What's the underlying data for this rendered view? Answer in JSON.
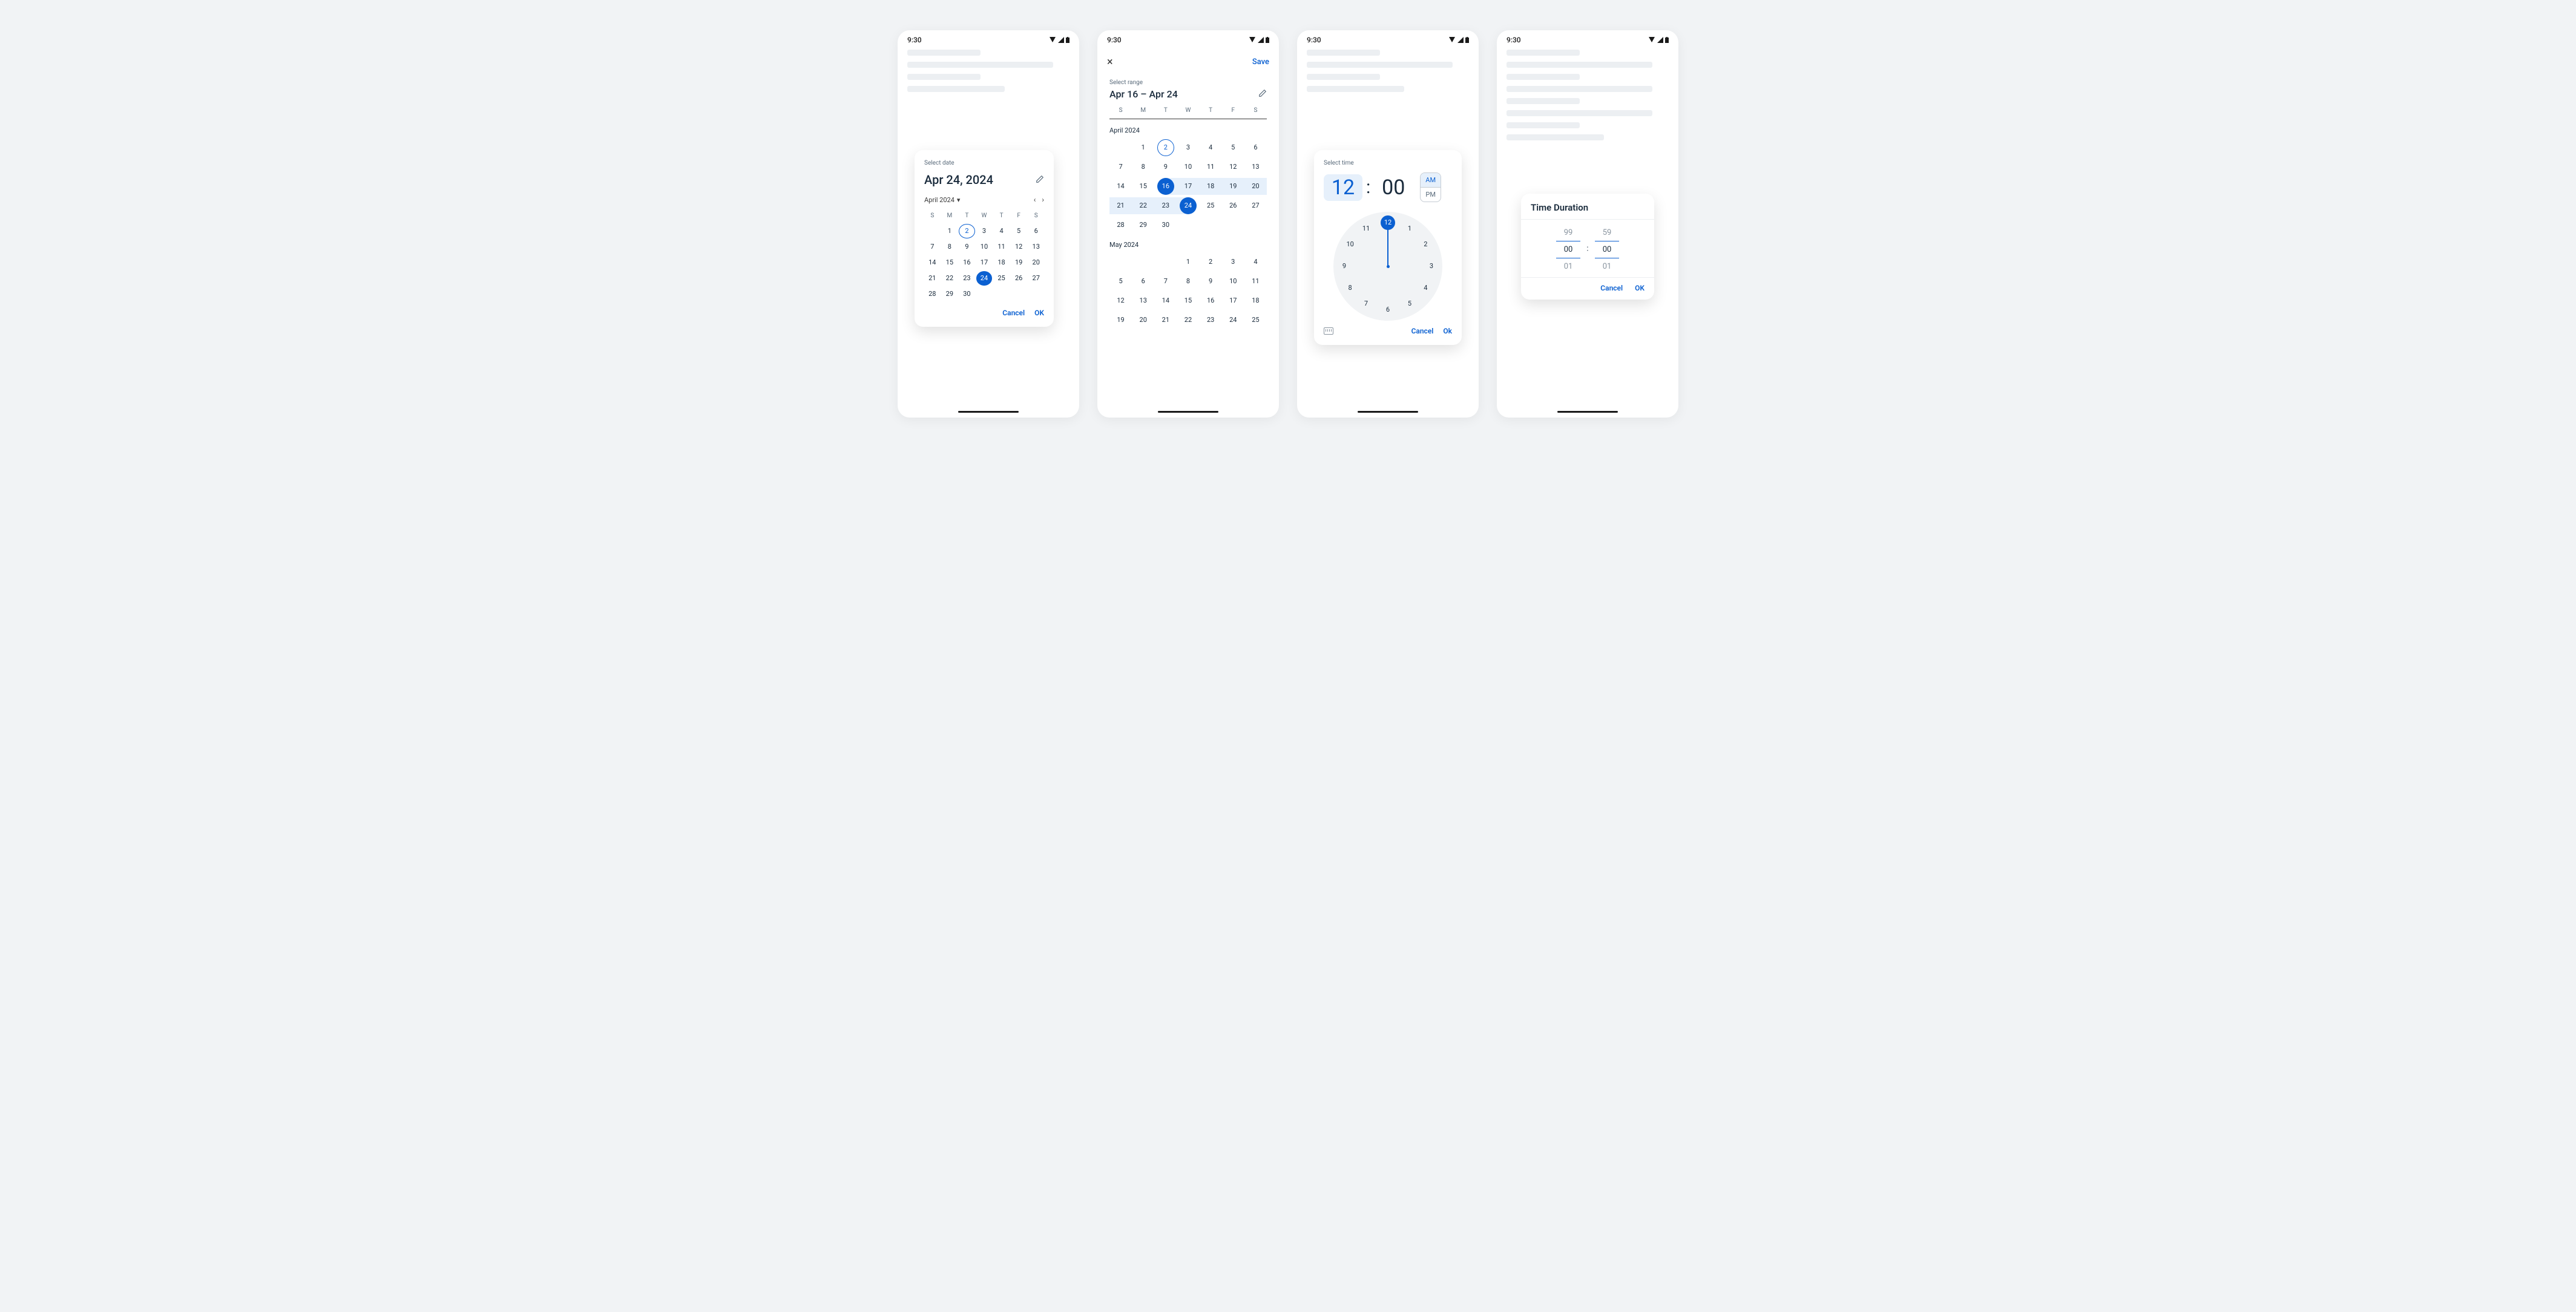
{
  "status_bar": {
    "time": "9:30"
  },
  "date_picker": {
    "label": "Select date",
    "headline": "Apr 24, 2024",
    "month_label": "April 2024",
    "dow": [
      "S",
      "M",
      "T",
      "W",
      "T",
      "F",
      "S"
    ],
    "days": [
      null,
      "1",
      "2",
      "3",
      "4",
      "5",
      "6",
      "7",
      "8",
      "9",
      "10",
      "11",
      "12",
      "13",
      "14",
      "15",
      "16",
      "17",
      "18",
      "19",
      "20",
      "21",
      "22",
      "23",
      "24",
      "25",
      "26",
      "27",
      "28",
      "29",
      "30"
    ],
    "today": "2",
    "selected": "24",
    "cancel": "Cancel",
    "ok": "OK"
  },
  "range_picker": {
    "close": "×",
    "save": "Save",
    "label": "Select range",
    "headline": "Apr 16 – Apr 24",
    "dow": [
      "S",
      "M",
      "T",
      "W",
      "T",
      "F",
      "S"
    ],
    "months": [
      {
        "header": "April 2024",
        "leading_blanks": 1,
        "days": [
          "1",
          "2",
          "3",
          "4",
          "5",
          "6",
          "7",
          "8",
          "9",
          "10",
          "11",
          "12",
          "13",
          "14",
          "15",
          "16",
          "17",
          "18",
          "19",
          "20",
          "21",
          "22",
          "23",
          "24",
          "25",
          "26",
          "27",
          "28",
          "29",
          "30"
        ],
        "today": "2",
        "range_start": "16",
        "range_end": "24"
      },
      {
        "header": "May 2024",
        "leading_blanks": 3,
        "days": [
          "1",
          "2",
          "3",
          "4",
          "5",
          "6",
          "7",
          "8",
          "9",
          "10",
          "11",
          "12",
          "13",
          "14",
          "15",
          "16",
          "17",
          "18",
          "19",
          "20",
          "21",
          "22",
          "23",
          "24",
          "25"
        ]
      }
    ]
  },
  "time_picker": {
    "label": "Select time",
    "hour": "12",
    "minute": "00",
    "colon": ":",
    "am": "AM",
    "pm": "PM",
    "am_active": true,
    "clock_numbers": [
      "12",
      "1",
      "2",
      "3",
      "4",
      "5",
      "6",
      "7",
      "8",
      "9",
      "10",
      "11"
    ],
    "cancel": "Cancel",
    "ok": "Ok"
  },
  "duration_picker": {
    "title": "Time Duration",
    "col1": {
      "prev": "99",
      "cur": "00",
      "next": "01"
    },
    "col2": {
      "prev": "59",
      "cur": "00",
      "next": "01"
    },
    "cancel": "Cancel",
    "ok": "OK"
  }
}
